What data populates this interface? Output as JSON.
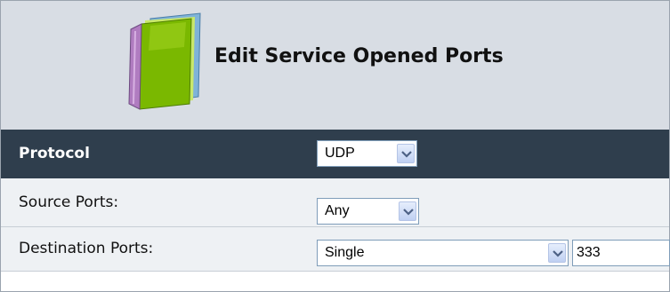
{
  "header": {
    "title": "Edit Service Opened Ports",
    "icon": "book-icon"
  },
  "form": {
    "protocol": {
      "label": "Protocol",
      "value": "UDP"
    },
    "source_ports": {
      "label": "Source Ports:",
      "value": "Any"
    },
    "destination_ports": {
      "label": "Destination Ports:",
      "value": "Single",
      "port": "333"
    }
  },
  "colors": {
    "header_bg": "#d8dde4",
    "protocol_row_bg": "#2f3e4d",
    "row_bg": "#eef1f4",
    "accent": "#7ab800"
  }
}
